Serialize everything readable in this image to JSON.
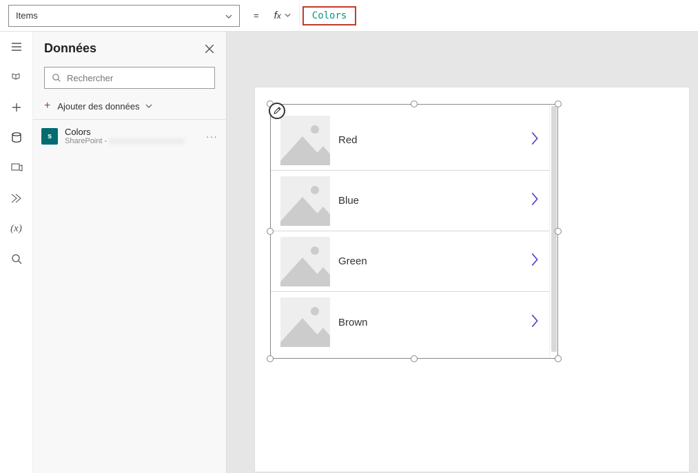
{
  "formula_bar": {
    "property": "Items",
    "value": "Colors"
  },
  "panel": {
    "title": "Données",
    "search_placeholder": "Rechercher",
    "add_label": "Ajouter des données",
    "data_source": {
      "name": "Colors",
      "subtitle_prefix": "SharePoint - "
    }
  },
  "gallery": {
    "items": [
      {
        "title": "Red"
      },
      {
        "title": "Blue"
      },
      {
        "title": "Green"
      },
      {
        "title": "Brown"
      }
    ]
  }
}
